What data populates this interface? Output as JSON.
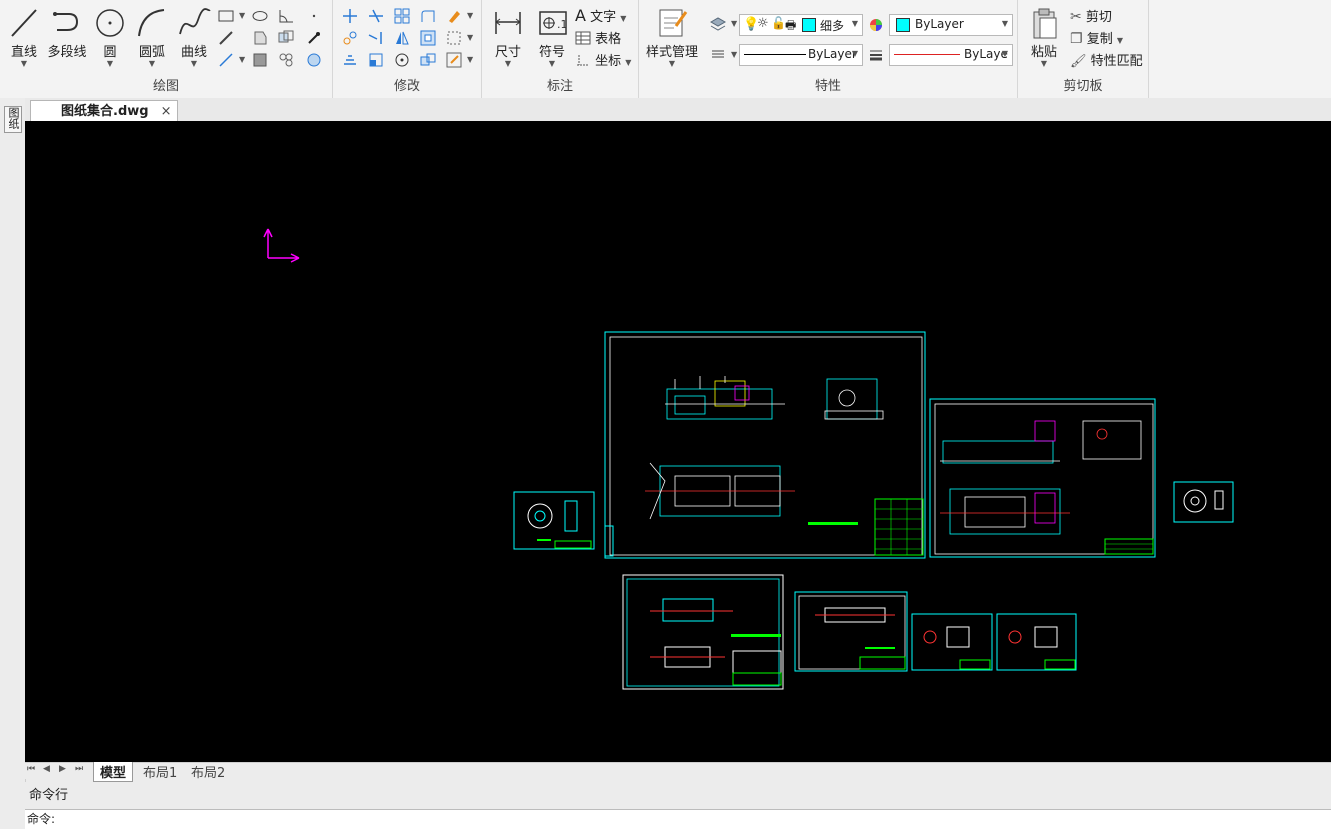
{
  "ribbon": {
    "draw": {
      "label": "绘图",
      "line": "直线",
      "polyline": "多段线",
      "circle": "圆",
      "arc": "圆弧",
      "curve": "曲线"
    },
    "modify": {
      "label": "修改"
    },
    "annotate": {
      "label": "标注",
      "dimension": "尺寸",
      "symbol": "符号",
      "text": "文字",
      "table": "表格",
      "coordinate": "坐标"
    },
    "properties": {
      "label": "特性",
      "style_manager": "样式管理",
      "layer_name": "细多",
      "color_value": "ByLayer",
      "linetype_value": "ByLayer",
      "lineweight_value": "ByLaye"
    },
    "clipboard": {
      "label": "剪切板",
      "paste": "粘贴",
      "cut": "剪切",
      "copy": "复制",
      "match": "特性匹配"
    }
  },
  "document": {
    "tab_title": "图纸集合.dwg",
    "close": "×",
    "side_label": "图纸"
  },
  "layout_tabs": {
    "nav": [
      "⏮",
      "◀",
      "▶",
      "⏭"
    ],
    "tabs": [
      "模型",
      "布局1",
      "布局2"
    ]
  },
  "command": {
    "header": "命令行",
    "prompt": "命令:"
  },
  "colors": {
    "canvas": "#000000",
    "frame": "#00ffff",
    "ucs": "#ff00ff",
    "accent_green": "#00ff00",
    "swatch": "#00ffff"
  }
}
